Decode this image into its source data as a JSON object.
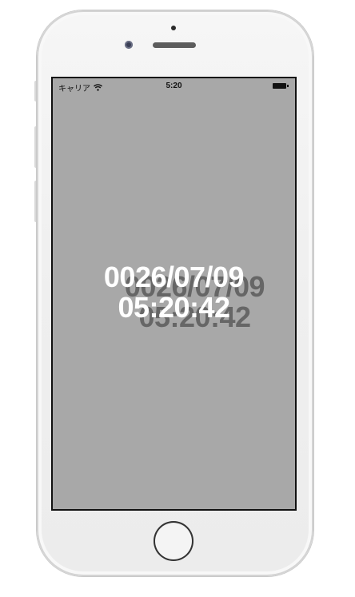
{
  "status_bar": {
    "carrier": "キャリア",
    "wifi_icon": "wifi-icon",
    "time": "5:20",
    "battery_icon": "battery-icon"
  },
  "clock": {
    "date": "0026/07/09",
    "time": "05:20:42"
  },
  "colors": {
    "screen_background": "#a8a8a8",
    "text": "#ffffff",
    "text_shadow": "#666666"
  }
}
